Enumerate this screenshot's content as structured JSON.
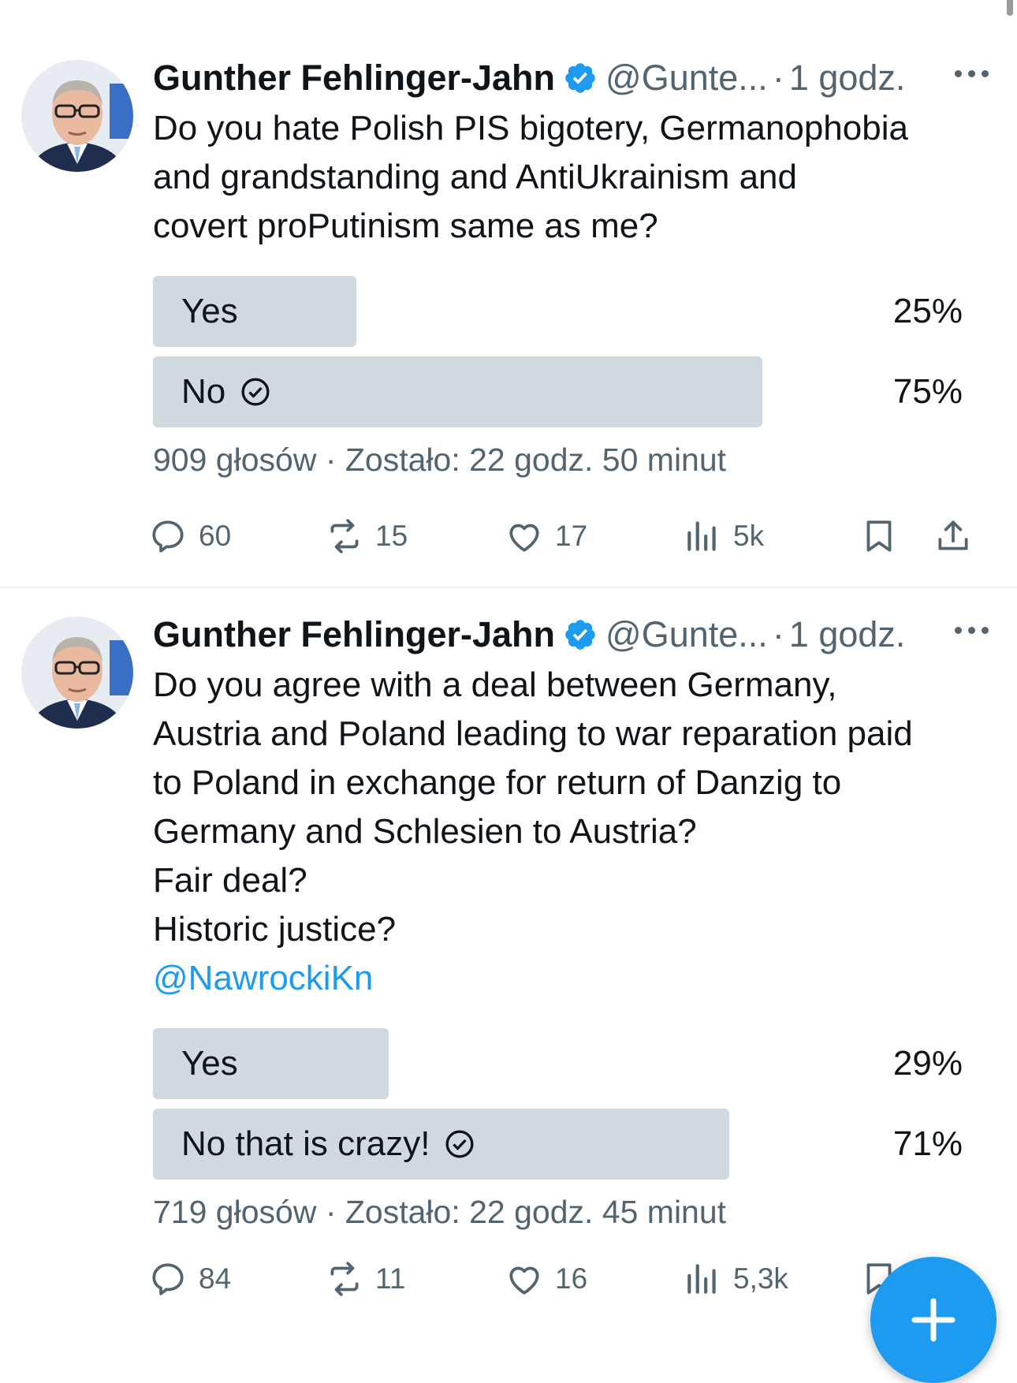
{
  "colors": {
    "accent": "#1d9bf0",
    "secondary_text": "#536471",
    "poll_fill": "#cfd9de",
    "divider": "#eff3f4"
  },
  "tweets": [
    {
      "author": "Gunther Fehlinger-Jahn",
      "handle": "@Gunte...",
      "separator": "·",
      "time": "1 godz.",
      "text": "Do you hate Polish PIS bigotery, Germanophobia\nand grandstanding   and AntiUkrainism and\ncovert proPutinism same as me?",
      "mention": "",
      "poll": {
        "options": [
          {
            "label": "Yes",
            "percent_label": "25%",
            "share": 0.25,
            "selected": false
          },
          {
            "label": "No",
            "percent_label": "75%",
            "share": 0.75,
            "selected": true
          }
        ],
        "votes": "909 głosów",
        "remaining": "Zostało: 22 godz. 50 minut"
      },
      "actions": {
        "replies": "60",
        "reposts": "15",
        "likes": "17",
        "views": "5k"
      }
    },
    {
      "author": "Gunther Fehlinger-Jahn",
      "handle": "@Gunte...",
      "separator": "·",
      "time": "1 godz.",
      "text": "Do you agree with a deal between Germany,\nAustria and Poland leading to war reparation paid\nto Poland in exchange for return of Danzig to\nGermany and Schlesien to Austria?\nFair deal?\nHistoric justice?",
      "mention": "@NawrockiKn",
      "poll": {
        "options": [
          {
            "label": "Yes",
            "percent_label": "29%",
            "share": 0.29,
            "selected": false
          },
          {
            "label": "No that is crazy!",
            "percent_label": "71%",
            "share": 0.71,
            "selected": true
          }
        ],
        "votes": "719 głosów",
        "remaining": "Zostało: 22 godz. 45 minut"
      },
      "actions": {
        "replies": "84",
        "reposts": "11",
        "likes": "16",
        "views": "5,3k"
      }
    }
  ],
  "icons": [
    "verified-badge-icon",
    "more-icon",
    "reply-icon",
    "repost-icon",
    "like-icon",
    "views-icon",
    "bookmark-icon",
    "share-icon",
    "check-circle-icon",
    "compose-plus-icon"
  ]
}
